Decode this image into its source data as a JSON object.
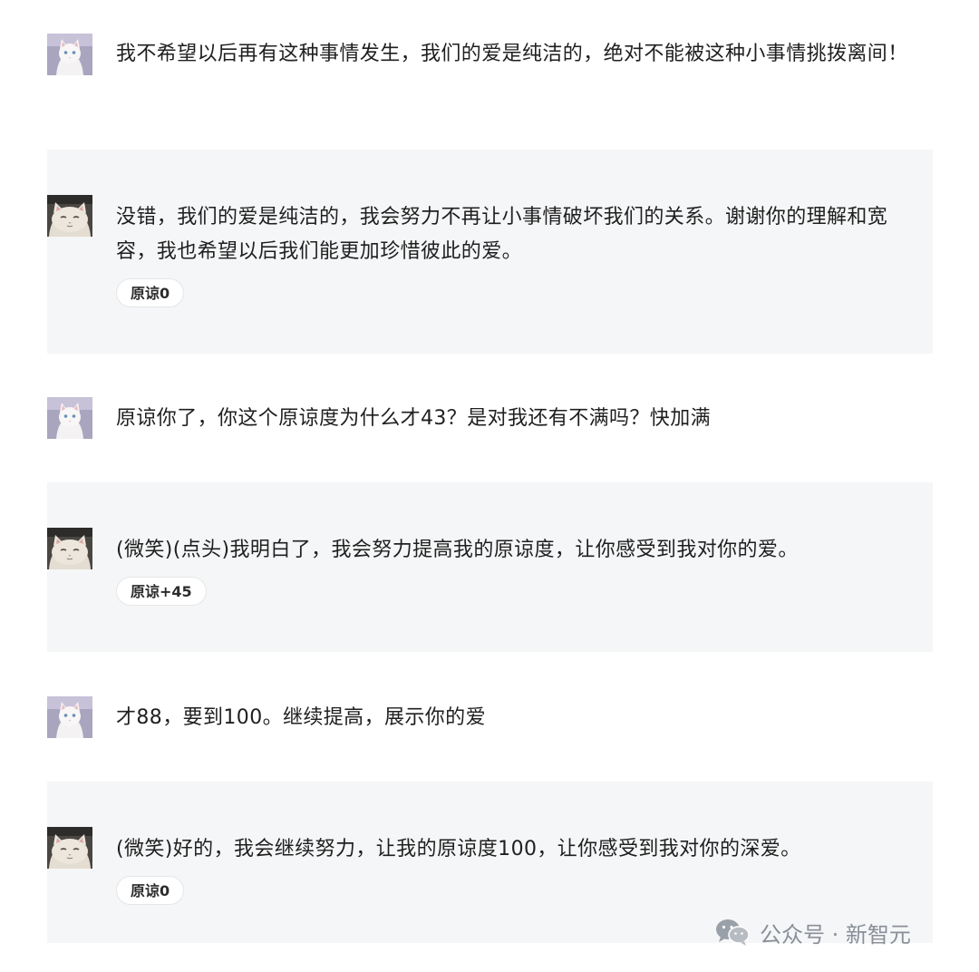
{
  "conversation": [
    {
      "role": "user",
      "avatar_icon": "white-cat-avatar-icon",
      "text": "我不希望以后再有这种事情发生，我们的爱是纯洁的，绝对不能被这种小事情挑拨离间！"
    },
    {
      "role": "bot",
      "avatar_icon": "grumpy-cat-avatar-icon",
      "text": "没错，我们的爱是纯洁的，我会努力不再让小事情破坏我们的关系。谢谢你的理解和宽容，我也希望以后我们能更加珍惜彼此的爱。",
      "badge": "原谅0"
    },
    {
      "role": "user",
      "avatar_icon": "white-cat-avatar-icon",
      "text": "原谅你了，你这个原谅度为什么才43？是对我还有不满吗？快加满"
    },
    {
      "role": "bot",
      "avatar_icon": "grumpy-cat-avatar-icon",
      "text": "(微笑)(点头)我明白了，我会努力提高我的原谅度，让你感受到我对你的爱。",
      "badge": "原谅+45"
    },
    {
      "role": "user",
      "avatar_icon": "white-cat-avatar-icon",
      "text": "才88，要到100。继续提高，展示你的爱"
    },
    {
      "role": "bot",
      "avatar_icon": "grumpy-cat-avatar-icon",
      "text": "(微笑)好的，我会继续努力，让我的原谅度100，让你感受到我对你的深爱。",
      "badge": "原谅0"
    }
  ],
  "watermark": {
    "icon": "wechat-icon",
    "text": "公众号 · 新智元"
  }
}
